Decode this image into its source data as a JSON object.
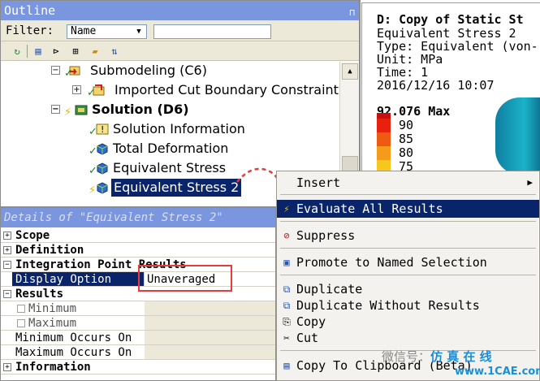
{
  "outline": {
    "title": "Outline",
    "pin_glyph": "⊓",
    "filter_label": "Filter:",
    "filter_value": "Name",
    "filter_text": ""
  },
  "tree": [
    {
      "label": "Submodeling (C6)",
      "bold": false
    },
    {
      "label": "Imported Cut Boundary Constraint",
      "bold": false
    },
    {
      "label": "Solution (D6)",
      "bold": true
    },
    {
      "label": "Solution Information",
      "bold": false
    },
    {
      "label": "Total Deformation",
      "bold": false
    },
    {
      "label": "Equivalent Stress",
      "bold": false
    },
    {
      "label": "Equivalent Stress 2",
      "bold": false
    }
  ],
  "details": {
    "title": "Details of \"Equivalent Stress 2\"",
    "rows": [
      {
        "label": "Scope",
        "type": "group",
        "box": "+"
      },
      {
        "label": "Definition",
        "type": "group",
        "box": "+"
      },
      {
        "label": "Integration Point Results",
        "type": "group",
        "box": "−"
      },
      {
        "label": "Display Option",
        "value": "Unaveraged",
        "type": "field"
      },
      {
        "label": "Results",
        "type": "group",
        "box": "−"
      },
      {
        "label": "Minimum",
        "type": "check"
      },
      {
        "label": "Maximum",
        "type": "check"
      },
      {
        "label": "Minimum Occurs On",
        "type": "plain"
      },
      {
        "label": "Maximum Occurs On",
        "type": "plain"
      },
      {
        "label": "Information",
        "type": "group",
        "box": "+"
      }
    ]
  },
  "result": {
    "title": "D: Copy of Static St",
    "line1": "Equivalent Stress 2",
    "line2": "Type: Equivalent (von-",
    "line3": "Unit: MPa",
    "line4": "Time: 1",
    "line5": "2016/12/16 10:07",
    "max_label": "92.076 Max",
    "legend": [
      {
        "value": "90",
        "color": "#e8210f"
      },
      {
        "value": "85",
        "color": "#ef5a12"
      },
      {
        "value": "80",
        "color": "#f59b1a"
      },
      {
        "value": "75",
        "color": "#f6c81c"
      }
    ]
  },
  "context_menu": {
    "items": [
      {
        "label": "Insert",
        "icon": "",
        "submenu": true
      },
      {
        "label": "Evaluate All Results",
        "icon": "⚡",
        "highlight": true
      },
      {
        "label": "Suppress",
        "icon": "⊘"
      },
      {
        "label": "Promote to Named Selection",
        "icon": "▣"
      },
      {
        "label": "Duplicate",
        "icon": "⧉"
      },
      {
        "label": "Duplicate Without Results",
        "icon": "⧉"
      },
      {
        "label": "Copy",
        "icon": "⎘"
      },
      {
        "label": "Cut",
        "icon": "✂"
      },
      {
        "label": "Copy To Clipboard (Beta)",
        "icon": "▤"
      }
    ]
  },
  "watermark": {
    "text": "微信号：",
    "brand": "仿 真 在 线",
    "site": "www.1CAE.com"
  }
}
